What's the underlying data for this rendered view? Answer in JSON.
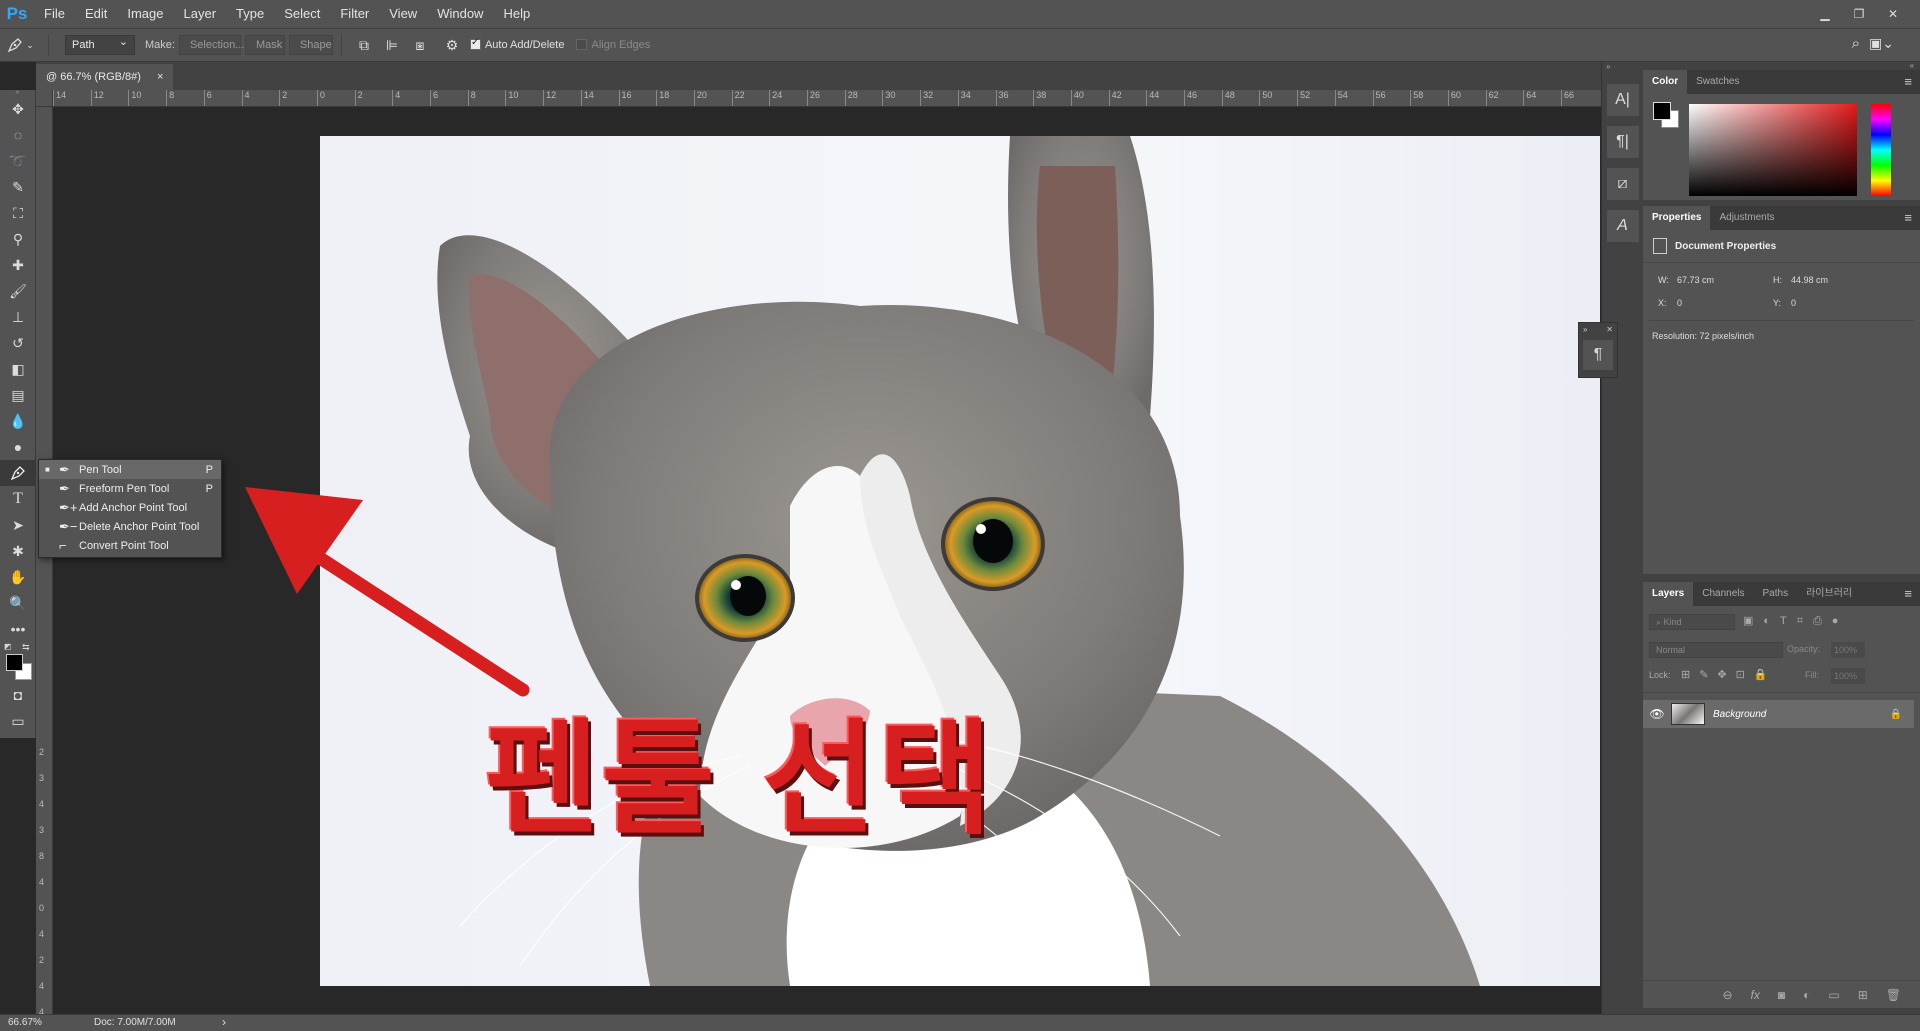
{
  "app": {
    "logo": "Ps"
  },
  "menu": [
    "File",
    "Edit",
    "Image",
    "Layer",
    "Type",
    "Select",
    "Filter",
    "View",
    "Window",
    "Help"
  ],
  "options": {
    "mode": "Path",
    "make_label": "Make:",
    "selection": "Selection...",
    "mask": "Mask",
    "shape": "Shape",
    "auto_add_delete": "Auto Add/Delete",
    "align_edges": "Align Edges"
  },
  "document": {
    "tab_title": "@ 66.7% (RGB/8#)",
    "close": "×"
  },
  "ruler_h": [
    "14",
    "12",
    "10",
    "8",
    "6",
    "4",
    "2",
    "0",
    "2",
    "4",
    "6",
    "8",
    "10",
    "12",
    "14",
    "16",
    "18",
    "20",
    "22",
    "24",
    "26",
    "28",
    "30",
    "32",
    "34",
    "36",
    "38",
    "40",
    "42",
    "44",
    "46",
    "48",
    "50",
    "52",
    "54",
    "56",
    "58",
    "60",
    "62",
    "64",
    "66"
  ],
  "ruler_v": [
    "2",
    "3",
    "4",
    "3",
    "8",
    "4",
    "0",
    "4",
    "2",
    "4",
    "4"
  ],
  "flyout": [
    {
      "label": "Pen Tool",
      "key": "P",
      "selected": true
    },
    {
      "label": "Freeform Pen Tool",
      "key": "P",
      "selected": false
    },
    {
      "label": "Add Anchor Point Tool",
      "key": "",
      "selected": false
    },
    {
      "label": "Delete Anchor Point Tool",
      "key": "",
      "selected": false
    },
    {
      "label": "Convert Point Tool",
      "key": "",
      "selected": false
    }
  ],
  "annotation": {
    "text": "펜툴 선택",
    "color": "#d81f1f"
  },
  "color_panel": {
    "tabs": [
      "Color",
      "Swatches"
    ]
  },
  "properties_panel": {
    "tabs": [
      "Properties",
      "Adjustments"
    ],
    "title": "Document Properties",
    "w_label": "W:",
    "w_value": "67.73 cm",
    "h_label": "H:",
    "h_value": "44.98 cm",
    "x_label": "X:",
    "x_value": "0",
    "y_label": "Y:",
    "y_value": "0",
    "resolution": "Resolution: 72 pixels/inch"
  },
  "layers_panel": {
    "tabs": [
      "Layers",
      "Channels",
      "Paths",
      "라이브러리"
    ],
    "kind": "Kind",
    "blend": "Normal",
    "opacity_label": "Opacity:",
    "opacity_value": "100%",
    "lock_label": "Lock:",
    "fill_label": "Fill:",
    "fill_value": "100%",
    "layer_name": "Background"
  },
  "status": {
    "zoom": "66.67%",
    "doc": "Doc: 7.00M/7.00M",
    "arrow": "›"
  }
}
